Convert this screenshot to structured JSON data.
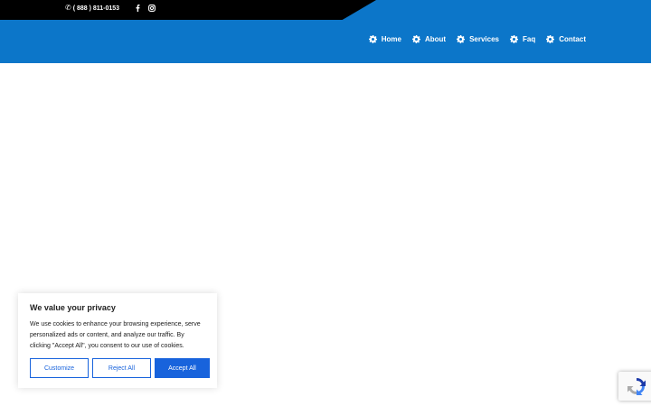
{
  "topbar": {
    "phone": "( 888 ) 811-0153",
    "phone_icon": "phone-icon",
    "social": [
      "facebook-icon",
      "instagram-icon"
    ]
  },
  "nav": {
    "items": [
      {
        "label": "Home",
        "icon": "gear-icon"
      },
      {
        "label": "About",
        "icon": "gear-icon"
      },
      {
        "label": "Services",
        "icon": "gear-icon"
      },
      {
        "label": "Faq",
        "icon": "gear-icon"
      },
      {
        "label": "Contact",
        "icon": "gear-icon"
      }
    ]
  },
  "cookie": {
    "title": "We value your privacy",
    "text": "We use cookies to enhance your browsing experience, serve personalized ads or content, and analyze our traffic. By clicking \"Accept All\", you consent to our use of cookies.",
    "customize": "Customize",
    "reject": "Reject All",
    "accept": "Accept All"
  },
  "colors": {
    "brand_blue": "#0c76c9",
    "topbar_black": "#000000",
    "cookie_button_blue": "#1863dc"
  }
}
